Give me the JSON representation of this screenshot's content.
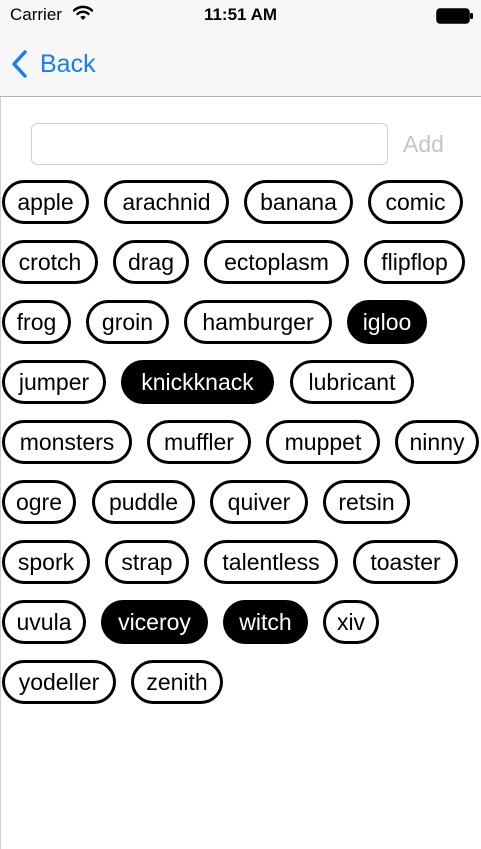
{
  "status_bar": {
    "carrier": "Carrier",
    "time": "11:51 AM"
  },
  "nav": {
    "back_label": "Back"
  },
  "add_form": {
    "input_value": "",
    "add_label": "Add"
  },
  "colors": {
    "accent": "#1a7cf5",
    "selected_tag_bg": "#000000",
    "tag_border": "#000000"
  },
  "tags": [
    {
      "label": "apple",
      "selected": false
    },
    {
      "label": "arachnid",
      "selected": false
    },
    {
      "label": "banana",
      "selected": false
    },
    {
      "label": "comic",
      "selected": false
    },
    {
      "label": "crotch",
      "selected": false
    },
    {
      "label": "drag",
      "selected": false
    },
    {
      "label": "ectoplasm",
      "selected": false
    },
    {
      "label": "flipflop",
      "selected": false
    },
    {
      "label": "frog",
      "selected": false
    },
    {
      "label": "groin",
      "selected": false
    },
    {
      "label": "hamburger",
      "selected": false
    },
    {
      "label": "igloo",
      "selected": true
    },
    {
      "label": "jumper",
      "selected": false
    },
    {
      "label": "knickknack",
      "selected": true
    },
    {
      "label": "lubricant",
      "selected": false
    },
    {
      "label": "monsters",
      "selected": false
    },
    {
      "label": "muffler",
      "selected": false
    },
    {
      "label": "muppet",
      "selected": false
    },
    {
      "label": "ninny",
      "selected": false
    },
    {
      "label": "ogre",
      "selected": false
    },
    {
      "label": "puddle",
      "selected": false
    },
    {
      "label": "quiver",
      "selected": false
    },
    {
      "label": "retsin",
      "selected": false
    },
    {
      "label": "spork",
      "selected": false
    },
    {
      "label": "strap",
      "selected": false
    },
    {
      "label": "talentless",
      "selected": false
    },
    {
      "label": "toaster",
      "selected": false
    },
    {
      "label": "uvula",
      "selected": false
    },
    {
      "label": "viceroy",
      "selected": true
    },
    {
      "label": "witch",
      "selected": true
    },
    {
      "label": "xiv",
      "selected": false
    },
    {
      "label": "yodeller",
      "selected": false
    },
    {
      "label": "zenith",
      "selected": false
    }
  ]
}
